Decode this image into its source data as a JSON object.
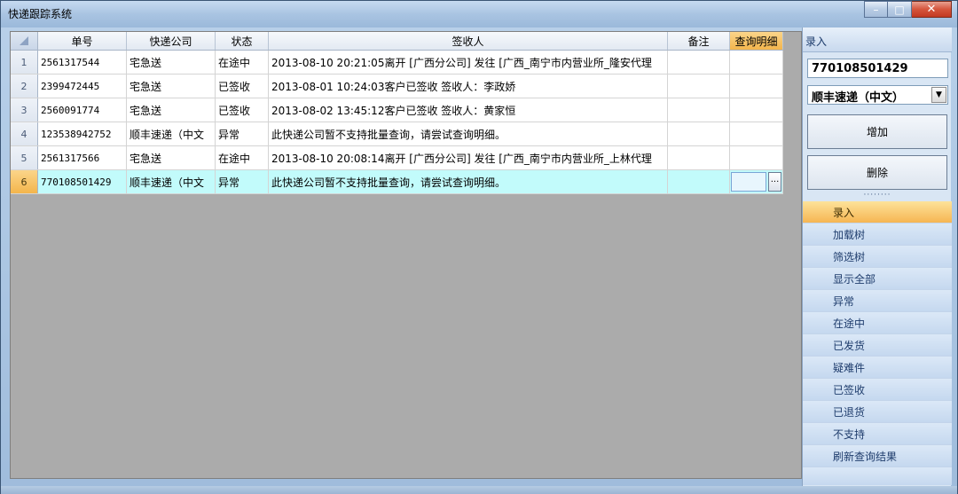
{
  "window": {
    "title": "快递跟踪系统",
    "minimize": "–",
    "maximize": "□",
    "close": "✕"
  },
  "grid": {
    "columns": [
      "单号",
      "快递公司",
      "状态",
      "签收人",
      "备注",
      "查询明细"
    ],
    "rows": [
      {
        "idx": "1",
        "no": "2561317544",
        "company": "宅急送",
        "status": "在途中",
        "sign": "2013-08-10  20:21:05离开 [广西分公司] 发往 [广西_南宁市内营业所_隆安代理",
        "note": "",
        "query": ""
      },
      {
        "idx": "2",
        "no": "2399472445",
        "company": "宅急送",
        "status": "已签收",
        "sign": "2013-08-01  10:24:03客户已签收 签收人：李政娇",
        "note": "",
        "query": ""
      },
      {
        "idx": "3",
        "no": "2560091774",
        "company": "宅急送",
        "status": "已签收",
        "sign": "2013-08-02  13:45:12客户已签收 签收人：黄家恒",
        "note": "",
        "query": ""
      },
      {
        "idx": "4",
        "no": "123538942752",
        "company": "顺丰速递（中文",
        "status": "异常",
        "sign": "此快递公司暂不支持批量查询，请尝试查询明细。",
        "note": "",
        "query": ""
      },
      {
        "idx": "5",
        "no": "2561317566",
        "company": "宅急送",
        "status": "在途中",
        "sign": "2013-08-10  20:08:14离开 [广西分公司] 发往 [广西_南宁市内营业所_上林代理",
        "note": "",
        "query": ""
      },
      {
        "idx": "6",
        "no": "770108501429",
        "company": "顺丰速递（中文",
        "status": "异常",
        "sign": "此快递公司暂不支持批量查询，请尝试查询明细。",
        "note": "",
        "query": "",
        "query_button": "···"
      }
    ]
  },
  "panel": {
    "header": "录入",
    "input_value": "770108501429",
    "select_value": "顺丰速递（中文）",
    "add_button": "增加",
    "delete_button": "删除",
    "splitter": "········",
    "nav": [
      "录入",
      "加载树",
      "筛选树",
      "显示全部",
      "异常",
      "在途中",
      "已发货",
      "疑难件",
      "已签收",
      "已退货",
      "不支持",
      "刷新查询结果"
    ]
  }
}
